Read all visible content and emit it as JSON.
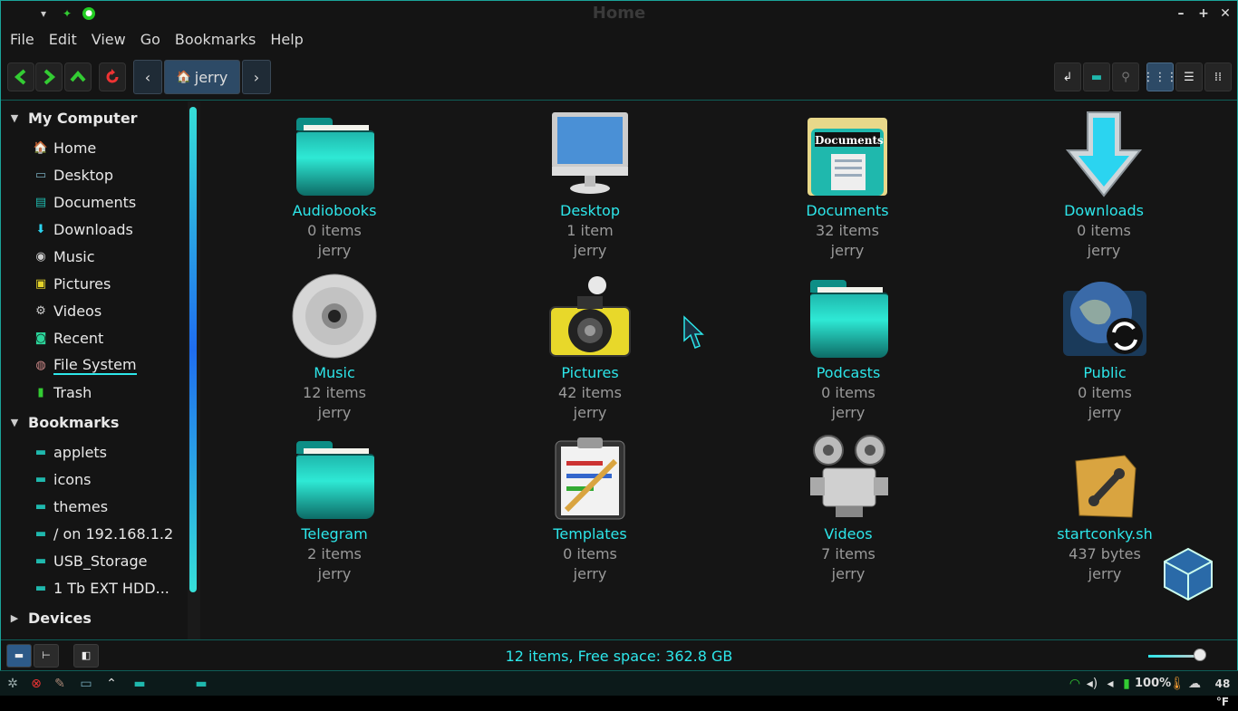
{
  "window": {
    "title": "Home"
  },
  "menubar": {
    "items": [
      "File",
      "Edit",
      "View",
      "Go",
      "Bookmarks",
      "Help"
    ]
  },
  "toolbar": {
    "breadcrumb": "jerry"
  },
  "sidebar": {
    "sections": [
      {
        "label": "My Computer",
        "items": [
          "Home",
          "Desktop",
          "Documents",
          "Downloads",
          "Music",
          "Pictures",
          "Videos",
          "Recent",
          "File System",
          "Trash"
        ]
      },
      {
        "label": "Bookmarks",
        "items": [
          "applets",
          "icons",
          "themes",
          "/ on 192.168.1.2",
          "USB_Storage",
          "1 Tb EXT HDD..."
        ]
      },
      {
        "label": "Devices",
        "items": []
      }
    ]
  },
  "files": [
    {
      "name": "Audiobooks",
      "count": "0 items",
      "owner": "jerry",
      "icon": "folder-icon"
    },
    {
      "name": "Desktop",
      "count": "1 item",
      "owner": "jerry",
      "icon": "monitor-icon"
    },
    {
      "name": "Documents",
      "count": "32 items",
      "owner": "jerry",
      "icon": "documents-folder-icon",
      "icon_label": "Documents"
    },
    {
      "name": "Downloads",
      "count": "0 items",
      "owner": "jerry",
      "icon": "download-arrow-icon"
    },
    {
      "name": "Music",
      "count": "12 items",
      "owner": "jerry",
      "icon": "cd-icon"
    },
    {
      "name": "Pictures",
      "count": "42 items",
      "owner": "jerry",
      "icon": "camera-icon"
    },
    {
      "name": "Podcasts",
      "count": "0 items",
      "owner": "jerry",
      "icon": "folder-icon"
    },
    {
      "name": "Public",
      "count": "0 items",
      "owner": "jerry",
      "icon": "globe-sync-icon"
    },
    {
      "name": "Telegram",
      "count": "2 items",
      "owner": "jerry",
      "icon": "folder-icon"
    },
    {
      "name": "Templates",
      "count": "0 items",
      "owner": "jerry",
      "icon": "clipboard-icon"
    },
    {
      "name": "Videos",
      "count": "7 items",
      "owner": "jerry",
      "icon": "film-projector-icon"
    },
    {
      "name": "startconky.sh",
      "count": "437 bytes",
      "owner": "jerry",
      "icon": "script-icon"
    }
  ],
  "statusbar": {
    "text": "12 items, Free space: 362.8 GB"
  },
  "taskbar": {
    "battery": "100%",
    "temperature": "48 °F"
  },
  "colors": {
    "accent": "#2de6ea",
    "folder": "#1fb8ad",
    "background": "#151515"
  }
}
